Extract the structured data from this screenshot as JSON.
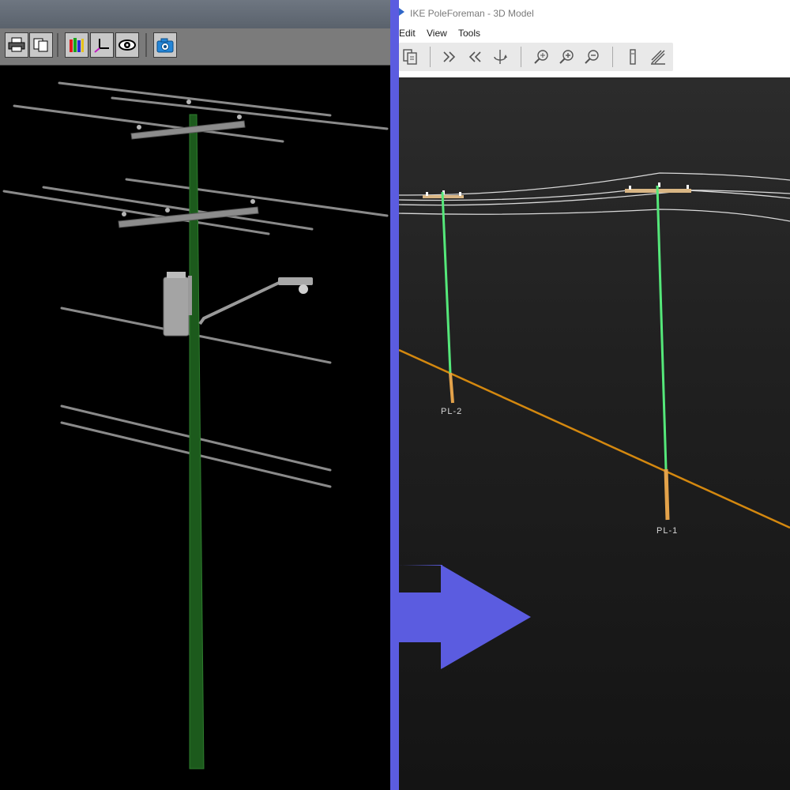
{
  "right_window": {
    "title": "IKE PoleForeman - 3D Model",
    "menu": [
      "Edit",
      "View",
      "Tools"
    ]
  },
  "right_toolbar": {
    "icons": [
      "page-setup-icon",
      "next-icon",
      "previous-icon",
      "rotate-icon",
      "zoom-extents-icon",
      "zoom-in-icon",
      "zoom-out-icon",
      "pole-view-icon",
      "span-view-icon"
    ]
  },
  "left_toolbar": {
    "icons": [
      "print-icon",
      "copy-icon",
      "layers-icon",
      "axes-icon",
      "eye-icon",
      "camera-icon"
    ]
  },
  "poles": [
    {
      "label": "PL-2"
    },
    {
      "label": "PL-1"
    }
  ],
  "colors": {
    "divider": "#5b5ce0",
    "arrow": "#5b5ce0",
    "pole_green_left": "#1c5a1c",
    "pole_green_right": "#55e87a",
    "pole_butt": "#e3a24a",
    "ground_line": "#d4880f"
  }
}
